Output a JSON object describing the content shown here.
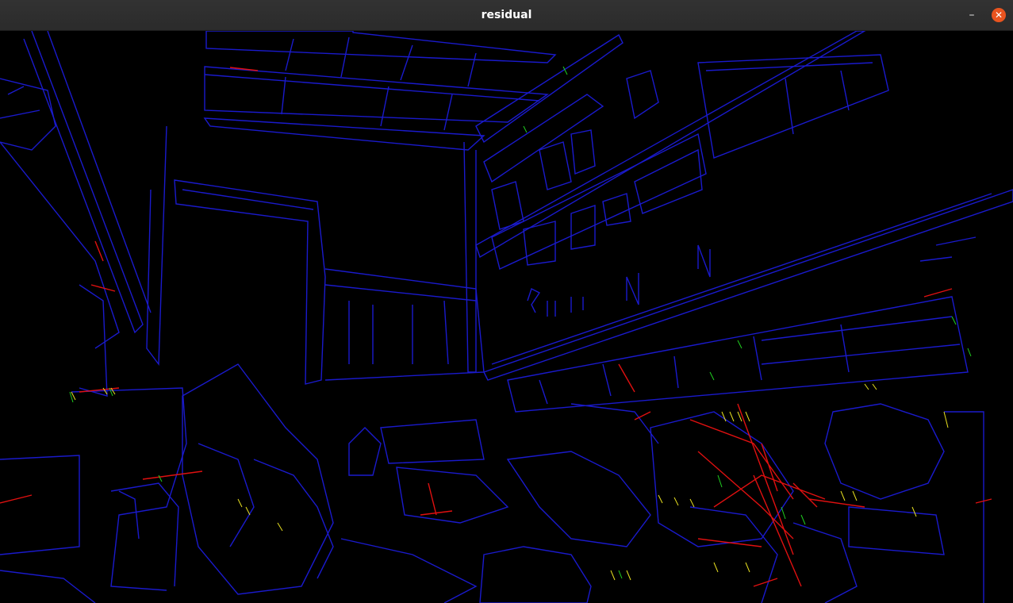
{
  "window": {
    "title": "residual",
    "minimize_glyph": "–",
    "close_glyph": "✕"
  },
  "colors": {
    "background": "#000000",
    "edges": "#1a1acc",
    "residual_red": "#e01010",
    "residual_yellow": "#e8e020",
    "residual_green": "#20d020",
    "close_button": "#e9541f"
  },
  "image": {
    "description_icon": "edge-residual-visualization"
  }
}
